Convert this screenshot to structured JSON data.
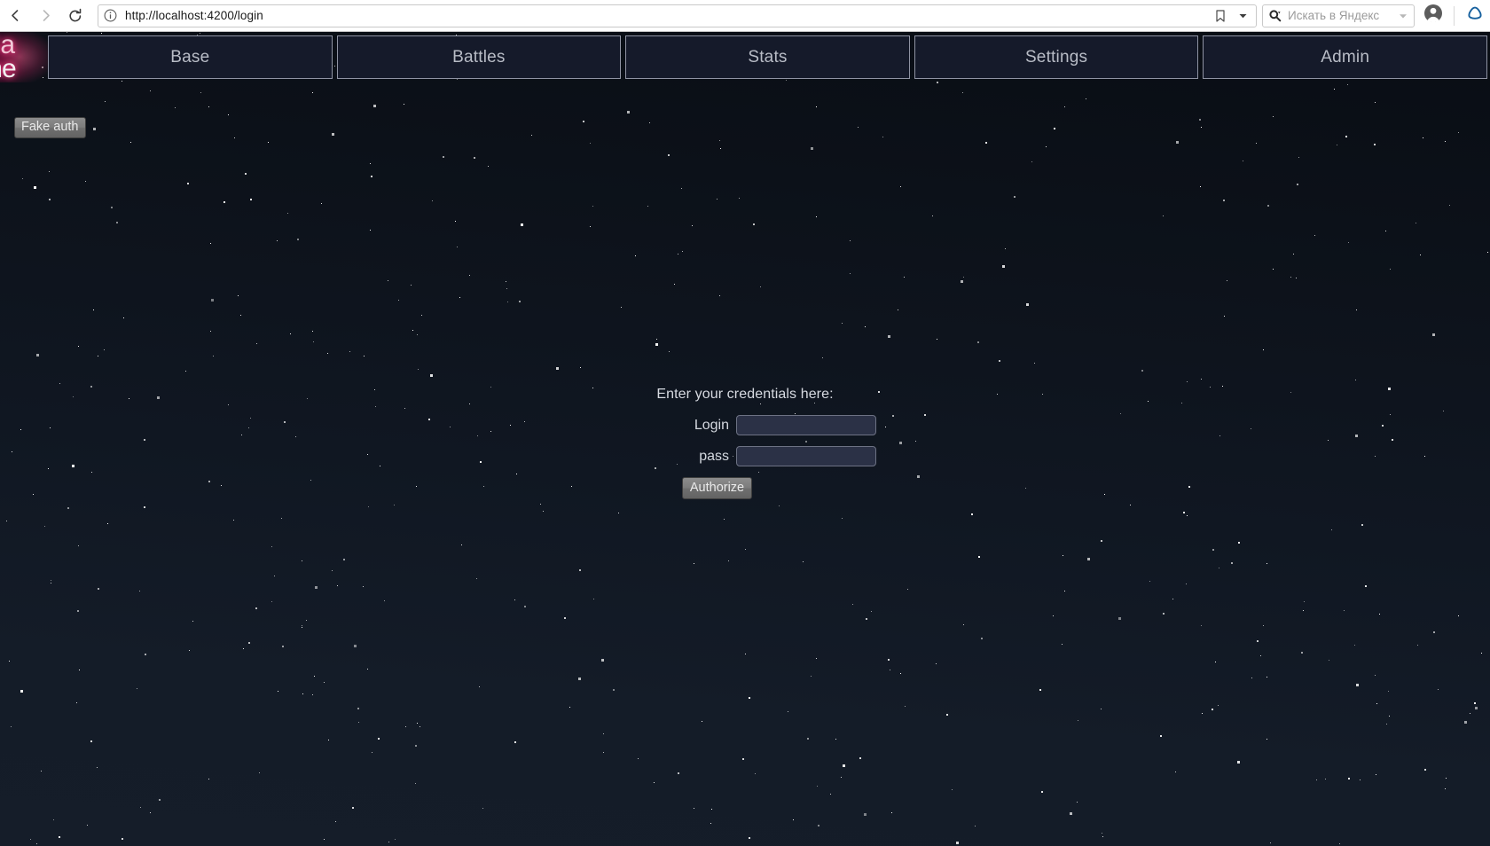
{
  "browser": {
    "back_icon": "back-arrow-icon",
    "forward_icon": "forward-arrow-icon",
    "reload_icon": "reload-icon",
    "info_icon": "page-info-icon",
    "url": "http://localhost:4200/login",
    "bookmark_icon": "bookmark-icon",
    "omnibox_dropdown_icon": "chevron-down-icon",
    "search_icon": "search-magnifier-icon",
    "search_placeholder": "Искать в Яндекс",
    "search_dropdown_icon": "chevron-down-icon",
    "avatar_icon": "user-avatar-icon",
    "yandex_icon": "yandex-browser-icon"
  },
  "app": {
    "logo_line1": "Ga",
    "logo_line2": "me",
    "logo_glow_color": "#ff3d86",
    "nav": [
      {
        "label": "Base"
      },
      {
        "label": "Battles"
      },
      {
        "label": "Stats"
      },
      {
        "label": "Settings"
      },
      {
        "label": "Admin"
      }
    ],
    "fake_auth_label": "Fake auth"
  },
  "login": {
    "title": "Enter your credentials here:",
    "fields": [
      {
        "label": "Login",
        "value": "",
        "placeholder": ""
      },
      {
        "label": "pass",
        "value": "",
        "placeholder": ""
      }
    ],
    "submit_label": "Authorize"
  },
  "theme": {
    "page_bg_top": "#090d14",
    "page_bg_bottom": "#151d29",
    "tab_bg": "#151a2a",
    "tab_border": "#8f93a3",
    "tab_text": "#b8bcc6",
    "input_bg": "#2b3146",
    "input_border": "#6d7284"
  }
}
